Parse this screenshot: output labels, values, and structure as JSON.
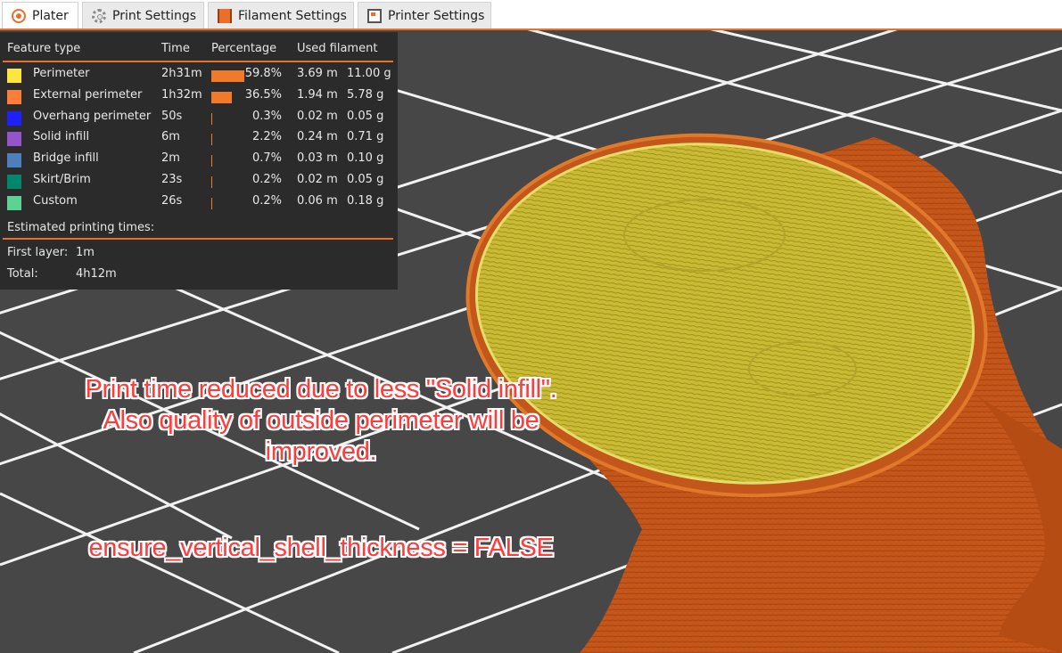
{
  "tabs": [
    {
      "label": "Plater",
      "icon": "plater-icon",
      "active": true
    },
    {
      "label": "Print Settings",
      "icon": "gear-icon",
      "active": false
    },
    {
      "label": "Filament Settings",
      "icon": "filament-spool-icon",
      "active": false
    },
    {
      "label": "Printer Settings",
      "icon": "printer-icon",
      "active": false
    }
  ],
  "legend": {
    "headers": {
      "feature_type": "Feature type",
      "time": "Time",
      "percentage": "Percentage",
      "used_filament": "Used filament"
    },
    "rows": [
      {
        "name": "Perimeter",
        "color": "#ffe540",
        "time": "2h31m",
        "percent_value": 59.8,
        "percent": "59.8%",
        "length": "3.69 m",
        "weight": "11.00 g"
      },
      {
        "name": "External perimeter",
        "color": "#ff7d38",
        "time": "1h32m",
        "percent_value": 36.5,
        "percent": "36.5%",
        "length": "1.94 m",
        "weight": "5.78 g"
      },
      {
        "name": "Overhang perimeter",
        "color": "#1f1fff",
        "time": "50s",
        "percent_value": 0.3,
        "percent": "0.3%",
        "length": "0.02 m",
        "weight": "0.05 g"
      },
      {
        "name": "Solid infill",
        "color": "#9654cc",
        "time": "6m",
        "percent_value": 2.2,
        "percent": "2.2%",
        "length": "0.24 m",
        "weight": "0.71 g"
      },
      {
        "name": "Bridge infill",
        "color": "#4d80ba",
        "time": "2m",
        "percent_value": 0.7,
        "percent": "0.7%",
        "length": "0.03 m",
        "weight": "0.10 g"
      },
      {
        "name": "Skirt/Brim",
        "color": "#00876e",
        "time": "23s",
        "percent_value": 0.2,
        "percent": "0.2%",
        "length": "0.02 m",
        "weight": "0.05 g"
      },
      {
        "name": "Custom",
        "color": "#5ed194",
        "time": "26s",
        "percent_value": 0.2,
        "percent": "0.2%",
        "length": "0.06 m",
        "weight": "0.18 g"
      }
    ],
    "estimated_title": "Estimated printing times:",
    "first_layer_label": "First layer:",
    "first_layer_value": "1m",
    "total_label": "Total:",
    "total_value": "4h12m"
  },
  "annotations": {
    "line1": "Print time reduced due to less \"Solid infill\".",
    "line2": "Also quality of outside perimeter will be",
    "line3": "improved.",
    "setting": "ensure_vertical_shell_thickness = FALSE"
  },
  "colors": {
    "accent": "#e8702a",
    "model_body": "#c4561a",
    "model_top": "#c8b830",
    "annotation_text": "#ff3b3b"
  }
}
